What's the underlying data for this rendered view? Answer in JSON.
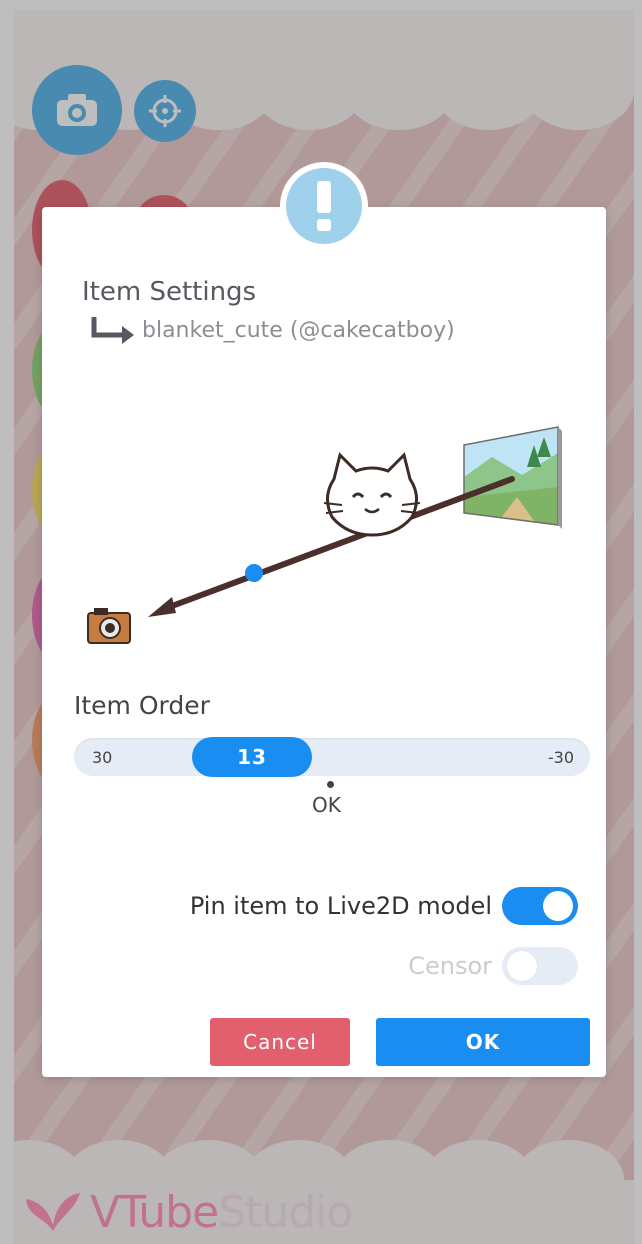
{
  "dialog": {
    "title": "Item Settings",
    "subtitle": "blanket_cute (@cakecatboy)",
    "item_order": {
      "label": "Item Order",
      "min_label": "30",
      "max_label": "-30",
      "value": "13",
      "ok_label": "OK"
    },
    "pin": {
      "label": "Pin item to Live2D model",
      "on": true
    },
    "censor": {
      "label": "Censor",
      "on": false
    },
    "cancel_label": "Cancel",
    "ok_label": "OK"
  },
  "logo": {
    "part1": "VTube",
    "part2": "Studio"
  },
  "colors": {
    "accent": "#1a8ef0",
    "cancel": "#e2606e",
    "alert": "#9fd0ec",
    "camera_button": "#2aa0e6"
  },
  "icons": [
    "camera-icon",
    "target-icon",
    "alert-icon",
    "return-arrow-icon",
    "cat-icon",
    "landscape-icon",
    "small-camera-icon",
    "butterfly-icon"
  ]
}
